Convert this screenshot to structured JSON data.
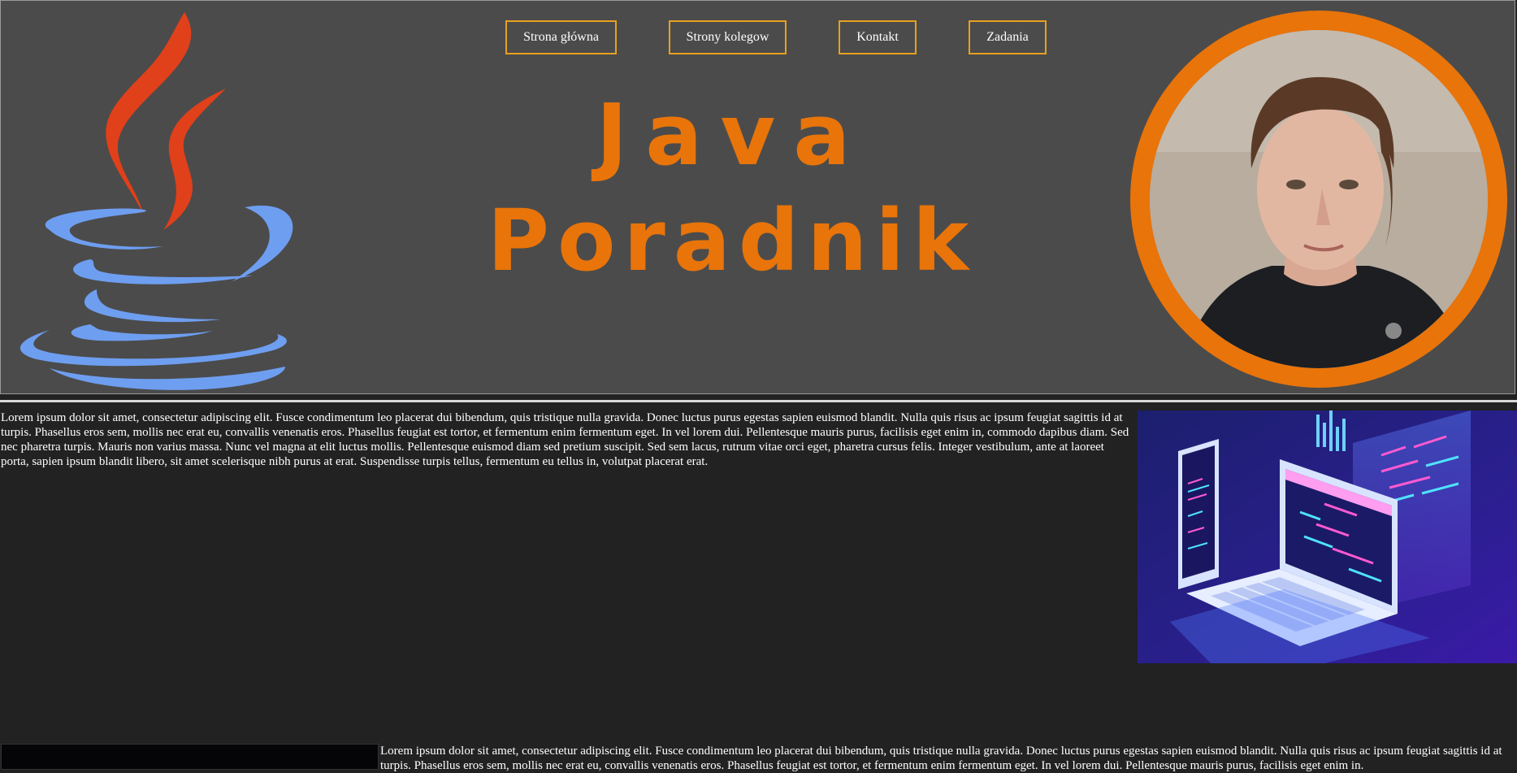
{
  "nav": {
    "items": [
      {
        "label": "Strona główna"
      },
      {
        "label": "Strony kolegow"
      },
      {
        "label": "Kontakt"
      },
      {
        "label": "Zadania"
      }
    ]
  },
  "header": {
    "title_line1": "Java",
    "title_line2": "Poradnik"
  },
  "colors": {
    "accent": "#e8740a",
    "nav_border": "#e8a020",
    "header_bg": "#4b4b4b",
    "page_bg": "#222222",
    "java_flame": "#e0401a",
    "java_cup": "#6e9ef0"
  },
  "icons": {
    "logo": "java-coffee-cup-logo",
    "avatar": "profile-photo",
    "illustration": "laptop-phone-code-isometric"
  },
  "content": {
    "paragraph1": "Lorem ipsum dolor sit amet, consectetur adipiscing elit. Fusce condimentum leo placerat dui bibendum, quis tristique nulla gravida. Donec luctus purus egestas sapien euismod blandit. Nulla quis risus ac ipsum feugiat sagittis id at turpis. Phasellus eros sem, mollis nec erat eu, convallis venenatis eros. Phasellus feugiat est tortor, et fermentum enim fermentum eget. In vel lorem dui. Pellentesque mauris purus, facilisis eget enim in, commodo dapibus diam. Sed nec pharetra turpis. Mauris non varius massa. Nunc vel magna at elit luctus mollis. Pellentesque euismod diam sed pretium suscipit. Sed sem lacus, rutrum vitae orci eget, pharetra cursus felis. Integer vestibulum, ante at laoreet porta, sapien ipsum blandit libero, sit amet scelerisque nibh purus at erat. Suspendisse turpis tellus, fermentum eu tellus in, volutpat placerat erat.",
    "paragraph2": "Lorem ipsum dolor sit amet, consectetur adipiscing elit. Fusce condimentum leo placerat dui bibendum, quis tristique nulla gravida. Donec luctus purus egestas sapien euismod blandit. Nulla quis risus ac ipsum feugiat sagittis id at turpis. Phasellus eros sem, mollis nec erat eu, convallis venenatis eros. Phasellus feugiat est tortor, et fermentum enim fermentum eget. In vel lorem dui. Pellentesque mauris purus, facilisis eget enim in."
  }
}
